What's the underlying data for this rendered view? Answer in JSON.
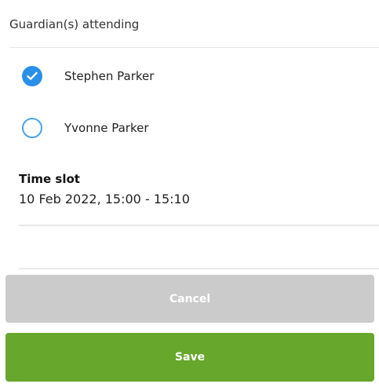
{
  "guardians": {
    "label": "Guardian(s) attending",
    "options": [
      {
        "name": "Stephen Parker",
        "checked": true
      },
      {
        "name": "Yvonne Parker",
        "checked": false
      }
    ]
  },
  "time_slot": {
    "title": "Time slot",
    "value": "10 Feb 2022, 15:00 - 15:10"
  },
  "actions": {
    "cancel_label": "Cancel",
    "save_label": "Save"
  },
  "colors": {
    "checked_radio": "#2a8fe8",
    "unchecked_radio_border": "#4aa3ee",
    "cancel_button": "#cbcbcb",
    "save_button": "#67a72b"
  }
}
